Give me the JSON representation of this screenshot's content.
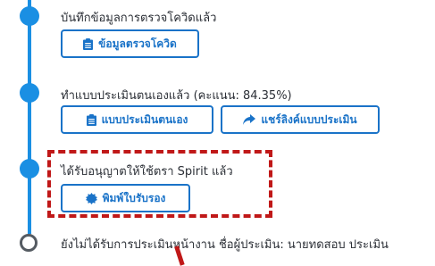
{
  "timeline": {
    "steps": [
      {
        "status": "done",
        "text": "บันทึกข้อมูลการตรวจโควิดแล้ว",
        "buttons": [
          {
            "label": "ข้อมูลตรวจโควิด",
            "icon": "clipboard-icon"
          }
        ]
      },
      {
        "status": "done",
        "text": "ทำแบบประเมินตนเองแล้ว (คะแนน: 84.35%)",
        "buttons": [
          {
            "label": "แบบประเมินตนเอง",
            "icon": "clipboard-icon"
          },
          {
            "label": "แชร์ลิงค์แบบประเมิน",
            "icon": "share-icon"
          }
        ]
      },
      {
        "status": "done",
        "text": "ได้รับอนุญาตให้ใช้ตรา Spirit แล้ว",
        "buttons": [
          {
            "label": "พิมพ์ใบรับรอง",
            "icon": "certificate-icon"
          }
        ]
      },
      {
        "status": "pending",
        "text": "ยังไม่ได้รับการประเมินหน้างาน ชื่อผู้ประเมิน: นายทดสอบ ประเมิน"
      }
    ]
  },
  "colors": {
    "accent": "#1a8fe3",
    "button_border": "#1a73c8",
    "highlight": "#c01818"
  }
}
